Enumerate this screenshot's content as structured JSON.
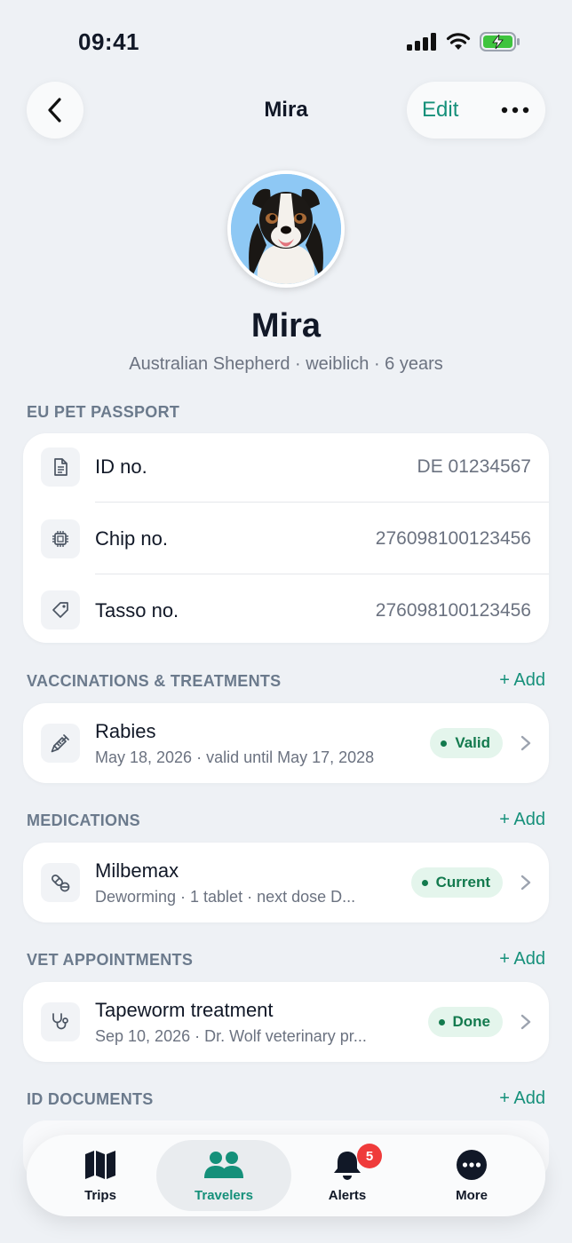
{
  "status_bar": {
    "time": "09:41"
  },
  "header": {
    "title": "Mira",
    "edit_label": "Edit"
  },
  "profile": {
    "name": "Mira",
    "subtitle": "Australian Shepherd · weiblich · 6 years"
  },
  "passport": {
    "section_label": "EU PET PASSPORT",
    "rows": [
      {
        "label": "ID no.",
        "value": "DE 01234567",
        "icon": "document-icon"
      },
      {
        "label": "Chip no.",
        "value": "276098100123456",
        "icon": "chip-icon"
      },
      {
        "label": "Tasso no.",
        "value": "276098100123456",
        "icon": "tag-icon"
      }
    ]
  },
  "vaccinations": {
    "section_label": "VACCINATIONS & TREATMENTS",
    "add_label": "+ Add",
    "item": {
      "title": "Rabies",
      "subtitle": "May 18, 2026 · valid until May 17, 2028",
      "badge": "Valid",
      "icon": "syringe-icon"
    }
  },
  "medications": {
    "section_label": "MEDICATIONS",
    "add_label": "+ Add",
    "item": {
      "title": "Milbemax",
      "subtitle": "Deworming · 1 tablet · next dose D...",
      "badge": "Current",
      "icon": "pill-icon"
    }
  },
  "vet_appointments": {
    "section_label": "VET APPOINTMENTS",
    "add_label": "+ Add",
    "item": {
      "title": "Tapeworm treatment",
      "subtitle": "Sep 10, 2026 · Dr. Wolf veterinary pr...",
      "badge": "Done",
      "icon": "stethoscope-icon"
    }
  },
  "id_documents": {
    "section_label": "ID DOCUMENTS",
    "add_label": "+ Add"
  },
  "tab_bar": {
    "tabs": [
      {
        "label": "Trips",
        "icon": "map-icon"
      },
      {
        "label": "Travelers",
        "icon": "people-icon",
        "active": true
      },
      {
        "label": "Alerts",
        "icon": "bell-icon",
        "badge": "5"
      },
      {
        "label": "More",
        "icon": "more-icon"
      }
    ]
  },
  "colors": {
    "background": "#eef1f5",
    "accent": "#15907a",
    "badge_green_bg": "#e4f5ec",
    "badge_green_text": "#137a4e",
    "alert_red": "#ef3b3b"
  }
}
